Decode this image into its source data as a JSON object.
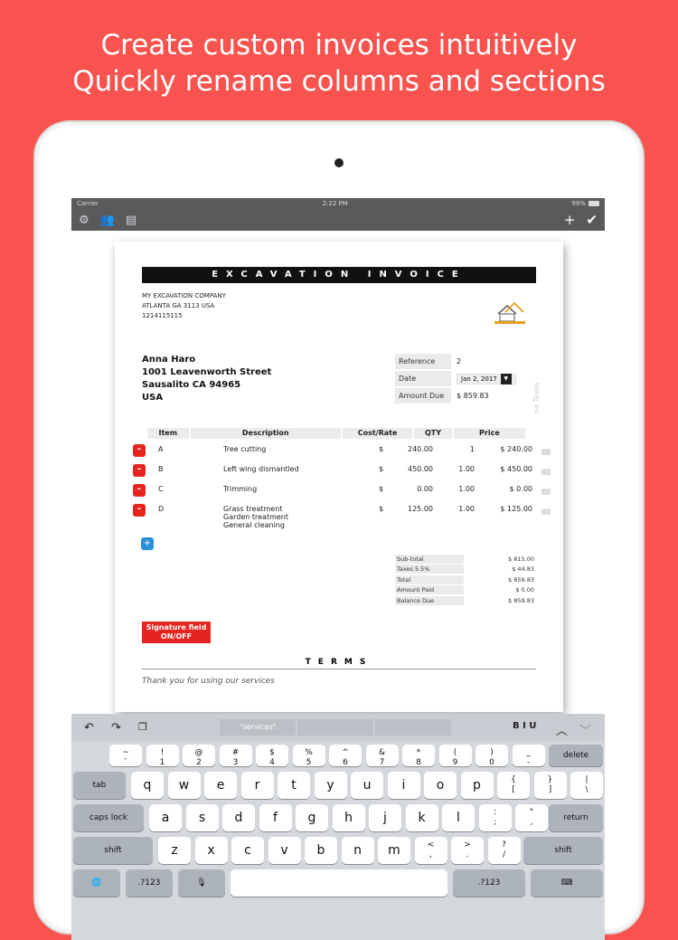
{
  "headline": [
    "Create custom invoices intuitively",
    "Quickly rename columns and sections"
  ],
  "status": {
    "carrier": "Carrier",
    "time": "2:22 PM",
    "battery": "99%"
  },
  "toolbar": {
    "gear_icon": "gear-icon",
    "people_icon": "people-icon",
    "folder_icon": "folder-icon",
    "add": "+",
    "check": "✔"
  },
  "invoice": {
    "title": "EXCAVATION INVOICE",
    "company": [
      "MY EXCAVATION COMPANY",
      "ATLANTA GA 3113  USA",
      "1214115115"
    ],
    "client": [
      "Anna Haro",
      "1001  Leavenworth Street",
      "Sausalito CA 94965",
      "USA"
    ],
    "reference_label": "Reference",
    "reference_value": "2",
    "date_label": "Date",
    "date_value": "Jan 2, 2017",
    "amount_due_label": "Amount Due",
    "amount_due_value": "$ 859.83",
    "no_taxes": "no Taxes",
    "columns": {
      "item": "Item",
      "description": "Description",
      "cost": "Cost/Rate",
      "qty": "QTY",
      "price": "Price"
    },
    "rows": [
      {
        "item": "A",
        "desc": "Tree cutting",
        "cur": "$",
        "cost": "240.00",
        "qty": "1",
        "price": "$ 240.00"
      },
      {
        "item": "B",
        "desc": "Left wing dismantled",
        "cur": "$",
        "cost": "450.00",
        "qty": "1.00",
        "price": "$ 450.00"
      },
      {
        "item": "C",
        "desc": "Trimming",
        "cur": "$",
        "cost": "0.00",
        "qty": "1.00",
        "price": "$ 0.00"
      },
      {
        "item": "D",
        "desc": "Grass treatment\nGarden treatment\nGeneral cleaning",
        "cur": "$",
        "cost": "125.00",
        "qty": "1.00",
        "price": "$ 125.00"
      }
    ],
    "totals": [
      {
        "label": "Sub-total",
        "value": "$ 815.00"
      },
      {
        "label": "Taxes 5.5%",
        "value": "$ 44.83"
      },
      {
        "label": "Total",
        "value": "$ 859.83"
      },
      {
        "label": "Amount Paid",
        "value": "$ 0.00"
      },
      {
        "label": "Balance Due",
        "value": "$ 859.83"
      }
    ],
    "signature_button": "Signature field\nON/OFF",
    "terms_title": "TERMS",
    "terms_text": "Thank you for using our services"
  },
  "keyboard": {
    "suggestion": "\"services\"",
    "format": "B I U",
    "row1": [
      [
        "~",
        "`"
      ],
      [
        "!",
        "1"
      ],
      [
        "@",
        "2"
      ],
      [
        "#",
        "3"
      ],
      [
        "$",
        "4"
      ],
      [
        "%",
        "5"
      ],
      [
        "^",
        "6"
      ],
      [
        "&",
        "7"
      ],
      [
        "*",
        "8"
      ],
      [
        "(",
        "9"
      ],
      [
        ")",
        "0"
      ],
      [
        "_",
        "-"
      ],
      [
        "+",
        "="
      ]
    ],
    "delete": "delete",
    "row2": [
      "q",
      "w",
      "e",
      "r",
      "t",
      "y",
      "u",
      "i",
      "o",
      "p"
    ],
    "row2_sym": [
      [
        "{",
        "["
      ],
      [
        "}",
        "]"
      ],
      [
        "|",
        "\\"
      ]
    ],
    "tab": "tab",
    "row3": [
      "a",
      "s",
      "d",
      "f",
      "g",
      "h",
      "j",
      "k",
      "l"
    ],
    "row3_sym": [
      [
        ":",
        ";"
      ],
      [
        "\"",
        ","
      ]
    ],
    "caps": "caps lock",
    "return": "return",
    "row4": [
      "z",
      "x",
      "c",
      "v",
      "b",
      "n",
      "m"
    ],
    "row4_sym": [
      [
        "<",
        ","
      ],
      [
        ">",
        "."
      ],
      [
        "?",
        "/"
      ]
    ],
    "shift": "shift",
    "numbers": ".?123"
  }
}
